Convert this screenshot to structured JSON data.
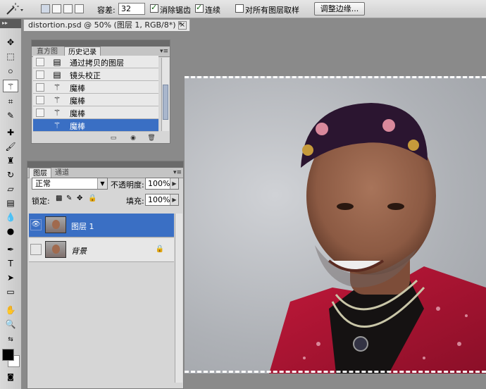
{
  "options_bar": {
    "tolerance_label": "容差:",
    "tolerance_value": "32",
    "antialias_label": "消除锯齿",
    "antialias_checked": true,
    "contiguous_label": "连续",
    "contiguous_checked": true,
    "sample_all_label": "对所有图层取样",
    "sample_all_checked": false,
    "refine_edge_label": "调整边缘..."
  },
  "document": {
    "tab_title": "distortion.psd @ 50% (图层 1, RGB/8*) *",
    "close_glyph": "×"
  },
  "history_panel": {
    "tabs": [
      {
        "label": "直方图",
        "active": false
      },
      {
        "label": "历史记录",
        "active": true
      }
    ],
    "items": [
      {
        "label": "通过拷贝的图层",
        "icon": "document-icon",
        "selected": false
      },
      {
        "label": "镜头校正",
        "icon": "document-icon",
        "selected": false
      },
      {
        "label": "魔棒",
        "icon": "magic-wand-icon",
        "selected": false
      },
      {
        "label": "魔棒",
        "icon": "magic-wand-icon",
        "selected": false
      },
      {
        "label": "魔棒",
        "icon": "magic-wand-icon",
        "selected": false
      },
      {
        "label": "魔棒",
        "icon": "magic-wand-icon",
        "selected": true
      }
    ]
  },
  "layers_panel": {
    "tabs": [
      {
        "label": "图层",
        "active": true
      },
      {
        "label": "通道",
        "active": false
      }
    ],
    "blend_mode": "正常",
    "opacity_label": "不透明度:",
    "opacity_value": "100%",
    "lock_label": "锁定:",
    "fill_label": "填充:",
    "fill_value": "100%",
    "layers": [
      {
        "name": "图层 1",
        "visible": true,
        "selected": true,
        "locked": false
      },
      {
        "name": "背景",
        "visible": false,
        "selected": false,
        "locked": true
      }
    ]
  },
  "colors": {
    "selection_blue": "#3a6fc4",
    "foreground": "#000000",
    "background": "#ffffff"
  }
}
